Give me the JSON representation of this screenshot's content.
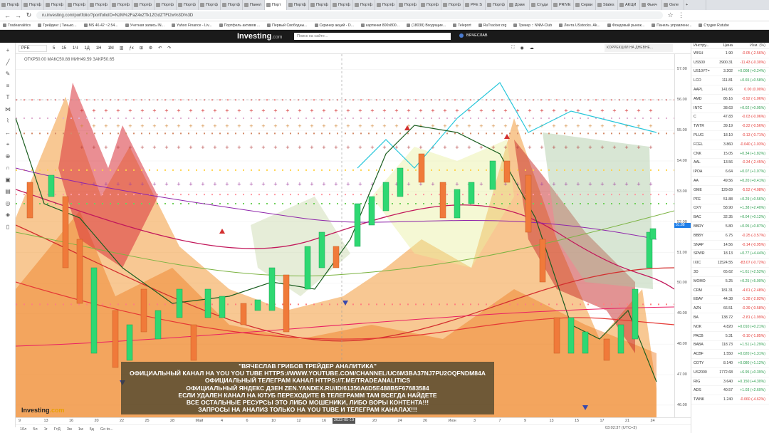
{
  "browser": {
    "tabs": [
      "Портф",
      "Портф",
      "Портф",
      "Портф",
      "Портф",
      "Портф",
      "Портф",
      "Портф",
      "Портф",
      "Портф",
      "Портф",
      "Панел",
      "Порт",
      "Портф",
      "Портф",
      "Портф",
      "Портф",
      "Портф",
      "Портф",
      "Портф",
      "Портф",
      "PFE S",
      "Портф",
      "Доми",
      "Студи",
      "PRIVE",
      "Серви",
      "States",
      "AKЦИ",
      "Фьюч",
      "Окле"
    ],
    "active_tab_index": 12,
    "url": "ru.investing.com/portfolio/?portfolioID=NzM%2FaZ4xZTk1ZGdZTFI2w%3D%3D",
    "bookmarks": [
      "Tradeanalitics",
      "Трейдинг | Тинько...",
      "MS 46.42 ~2.54...",
      "Учетная запись IN...",
      "Yahoo Finance - Liv...",
      "Портфель активов ...",
      "Первый Свободны...",
      "Скринер акций - D...",
      "картинки 800x800...",
      "(18038) Входящие...",
      "Teleport",
      "RuTracker.org",
      "Трекер :: NNM-Club",
      "Лента USstocks. Ak...",
      "Фондовый рынок...",
      "Панель управлени...",
      "Студия Rutube"
    ]
  },
  "investing": {
    "logo": "Investing",
    "logo_suffix": ".com",
    "search_placeholder": "Поиск на сайте...",
    "user": "ВЯЧЕСЛАВ"
  },
  "toolbar": {
    "symbol": "PFE",
    "intervals": [
      "5",
      "15",
      "1Ч",
      "1Д",
      "1Н",
      "1М"
    ],
    "corrections_label": "КОРРЕКЦИИ НА ДНЕВНЕ..."
  },
  "chart": {
    "ohlc": "ОТКР50.00   МАКС50.88   МИН49.59   ЗАКР50.65",
    "price_ticks": [
      "57.00",
      "56.00",
      "55.00",
      "54.00",
      "53.00",
      "52.00",
      "51.00",
      "50.00",
      "49.00",
      "48.00",
      "47.00",
      "46.00"
    ],
    "last_price": "51.88",
    "time_ticks": [
      "9",
      "13",
      "16",
      "20",
      "22",
      "25",
      "28",
      "Май",
      "4",
      "6",
      "10",
      "12",
      "16",
      "18",
      "20",
      "24",
      "26",
      "Июн",
      "3",
      "7",
      "9",
      "13",
      "15",
      "17",
      "21",
      "24"
    ],
    "crosshair_date": "2022-05-19",
    "overlay_lines": [
      "\"ВЯЧЕСЛАВ ГРИБОВ ТРЕЙДЕР АНАЛИТИКА\"",
      "ОФИЦИАЛЬНЫЙ КАНАЛ НА YOU YOU TUBE  HTTPS://WWW.YOUTUBE.COM/CHANNEL/UC6M3BA37NJ7PU2OQFNDM84A",
      "ОФИЦИАЛЬНЫЙ ТЕЛЕГРАМ КАНАЛ HTTPS://T.ME/TRADEANALITICS",
      "ОФИЦИАЛЬНЫЙ ЯНДЕКС ДЗЕН ZEN.YANDEX.RU/ID/61356A6D5E488B5F67683584",
      "ЕСЛИ УДАЛЕН КАНАЛ НА ЮТУБ ПЕРЕХОДИТЕ В ТЕЛЕГРАММ ТАМ ВСЕГДА НАЙДЕТЕ",
      "ВСЕ ОСТАЛЬНЫЕ РЕСУРСЫ ЭТО ЛИБО МОШЕНИКИ, ЛИБО ВОРЫ КОНТЕНТА!!!",
      "ЗАПРОСЫ НА АНАЛИЗ ТОЛЬКО НА YOU TUBE И ТЕЛЕГРАМ КАНАЛАХ!!!"
    ],
    "watermark": "Investing",
    "watermark_suffix": ".com"
  },
  "bottombar": {
    "ranges": [
      "10л",
      "5л",
      "1г",
      "ГтД",
      "3м",
      "1м",
      "5д",
      "Go to..."
    ],
    "clock": "03:02:37 (UTC+3)"
  },
  "watchlist": {
    "headers": [
      "Инстру...",
      "Цена",
      "Изм. (%)"
    ],
    "rows": [
      {
        "s": "WISH",
        "p": "1.90",
        "c": "-0.05 (-2.56%)",
        "d": "neg"
      },
      {
        "s": "US500",
        "p": "3900.31",
        "c": "-11.43 (-0.30%)",
        "d": "neg"
      },
      {
        "s": "US10YT=",
        "p": "3.202",
        "c": "+0.008 (+0.24%)",
        "d": "pos"
      },
      {
        "s": "LCO",
        "p": "111.81",
        "c": "+0.65 (+0.58%)",
        "d": "pos"
      },
      {
        "s": "AAPL",
        "p": "141.66",
        "c": "0.00 (0.00%)",
        "d": "neg"
      },
      {
        "s": "AMD",
        "p": "86.16",
        "c": "-0.92 (-1.06%)",
        "d": "neg"
      },
      {
        "s": "INTC",
        "p": "38.63",
        "c": "+0.02 (+0.05%)",
        "d": "pos"
      },
      {
        "s": "C",
        "p": "47.83",
        "c": "-0.03 (-0.06%)",
        "d": "neg"
      },
      {
        "s": "TWTR",
        "p": "39.19",
        "c": "-0.22 (-0.56%)",
        "d": "neg"
      },
      {
        "s": "PLUG",
        "p": "18.10",
        "c": "-0.13 (-0.71%)",
        "d": "neg"
      },
      {
        "s": "FCEL",
        "p": "3.860",
        "c": "-0.040 (-1.03%)",
        "d": "neg"
      },
      {
        "s": "CNK",
        "p": "15.05",
        "c": "+0.34 (+1.82%)",
        "d": "pos"
      },
      {
        "s": "AAL",
        "p": "13.56",
        "c": "-0.34 (-2.45%)",
        "d": "neg"
      },
      {
        "s": "IPOA",
        "p": "6.64",
        "c": "+0.07 (+1.07%)",
        "d": "pos"
      },
      {
        "s": "AA",
        "p": "49.56",
        "c": "+0.20 (+0.41%)",
        "d": "pos"
      },
      {
        "s": "GME",
        "p": "129.69",
        "c": "-5.52 (-4.08%)",
        "d": "neg"
      },
      {
        "s": "PFE",
        "p": "51.88",
        "c": "+0.29 (+0.56%)",
        "d": "pos"
      },
      {
        "s": "OXY",
        "p": "58.90",
        "c": "+1.38 (+2.40%)",
        "d": "pos"
      },
      {
        "s": "BAC",
        "p": "32.35",
        "c": "+0.04 (+0.12%)",
        "d": "pos"
      },
      {
        "s": "BBRY",
        "p": "5.80",
        "c": "+0.05 (+0.87%)",
        "d": "pos"
      },
      {
        "s": "BBBY",
        "p": "6.75",
        "c": "-0.25 (-3.57%)",
        "d": "neg"
      },
      {
        "s": "SNAP",
        "p": "14.56",
        "c": "-0.14 (-0.95%)",
        "d": "neg"
      },
      {
        "s": "SPWR",
        "p": "18.13",
        "c": "+0.77 (+4.44%)",
        "d": "pos"
      },
      {
        "s": "IXIC",
        "p": "11524.55",
        "c": "-83.07 (-0.72%)",
        "d": "neg"
      },
      {
        "s": "3D",
        "p": "65.62",
        "c": "+1.61 (+2.52%)",
        "d": "pos"
      },
      {
        "s": "MOMO",
        "p": "5.25",
        "c": "+0.25 (+5.00%)",
        "d": "pos"
      },
      {
        "s": "CRM",
        "p": "181.31",
        "c": "-4.61 (-2.48%)",
        "d": "neg"
      },
      {
        "s": "EBAY",
        "p": "44.38",
        "c": "-1.28 (-2.82%)",
        "d": "neg"
      },
      {
        "s": "AZN",
        "p": "66.51",
        "c": "-0.39 (-0.58%)",
        "d": "neg"
      },
      {
        "s": "BA",
        "p": "138.72",
        "c": "-2.81 (-1.99%)",
        "d": "neg"
      },
      {
        "s": "NOK",
        "p": "4.820",
        "c": "+0.010 (+0.21%)",
        "d": "pos"
      },
      {
        "s": "PACB",
        "p": "5.31",
        "c": "-0.10 (-1.85%)",
        "d": "neg"
      },
      {
        "s": "BABA",
        "p": "118.73",
        "c": "+1.51 (+1.29%)",
        "d": "pos"
      },
      {
        "s": "ACBF",
        "p": "1.550",
        "c": "+0.020 (+1.31%)",
        "d": "pos"
      },
      {
        "s": "COTY",
        "p": "8.140",
        "c": "+0.080 (+1.12%)",
        "d": "pos"
      },
      {
        "s": "US2000",
        "p": "1772.68",
        "c": "+6.95 (+0.39%)",
        "d": "pos"
      },
      {
        "s": "RIG",
        "p": "3.640",
        "c": "+0.150 (+4.30%)",
        "d": "pos"
      },
      {
        "s": "ADS",
        "p": "40.57",
        "c": "+1.03 (+2.60%)",
        "d": "pos"
      },
      {
        "s": "TWNK",
        "p": "1.240",
        "c": "-0.060 (-4.62%)",
        "d": "neg"
      }
    ]
  }
}
